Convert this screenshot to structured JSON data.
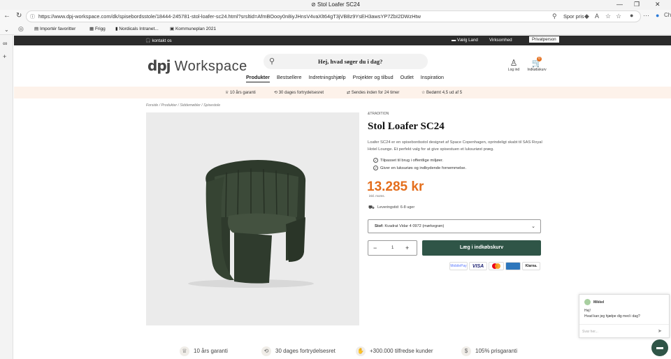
{
  "browser": {
    "tab_title": "Stol Loafer SC24",
    "url": "https://www.dpj-workspace.com/dk/spisebordsstole/18444-245781-stol-loafer-sc24.html?srsltid=AfmBOooy0n8iyJHnsV4vaXlt64gT3jVB8z9YsEH3awsYP7ZbI2DWzHtw",
    "spor_pris": "Spor pris",
    "favorites": [
      "Importér favoritter",
      "Frigg",
      "Nordicals Intranet...",
      "Kommuneplan 2021"
    ],
    "side_tab": "Ch"
  },
  "topstrip": {
    "contact": "kontakt os",
    "country": "Vælg Land",
    "business": "Virksomhed",
    "private": "Privatperson"
  },
  "header": {
    "logo_mark": "dpj",
    "logo_text": "Workspace",
    "search_placeholder": "Hej, hvad søger du i dag?",
    "menu": [
      "Produkter",
      "Bestsellere",
      "Indretningshjælp",
      "Projekter og tilbud",
      "Outlet",
      "Inspiration"
    ],
    "login": "Log ind",
    "cart": "Indkøbskurv",
    "cart_count": "0"
  },
  "usp": [
    "10 års garanti",
    "30 dages fortrydelsesret",
    "Sendes inden for 24 timer",
    "Bedømt 4,5 ud af 5"
  ],
  "breadcrumb": "Forside / Produkter / Siddemøbler / Spisestole",
  "product": {
    "brand": "&TRADITION",
    "title": "Stol Loafer SC24",
    "description": "Loafer SC24 er en spisebordsstol designet af Space Copenhagen, oprindeligt skabt til SAS Royal Hotel Lounge. Et perfekt valg for at give spisestuen et luksuriøst præg.",
    "bullets": [
      "Tilpasset til brug i offentlige miljøer.",
      "Giver en luksuriøs og indbydende fornemmelse."
    ],
    "price": "13.285 kr",
    "price_note": "inkl. moms.",
    "delivery": "Leveringstid: 6-8 uger",
    "option_label": "Stof:",
    "option_value": "Kvadrat Vidar 4 0972 (mørkegrøn)",
    "quantity": "1",
    "add_to_cart": "Læg i indkøbskurv",
    "payments": [
      "MobilePay",
      "VISA",
      "",
      "",
      "Klarna."
    ]
  },
  "chat": {
    "agent": "Mikkel",
    "greeting": "Hej!",
    "message": "Hvad kan jeg hjælpe dig med i dag?",
    "input_placeholder": "Svar her..."
  },
  "bottom_usp": [
    "10 års garanti",
    "30 dages fortrydelsesret",
    "+300.000 tilfredse kunder",
    "105% prisgaranti"
  ],
  "colors": {
    "accent": "#2f5547",
    "price": "#e46e1c",
    "usp_bg": "#fdf2ea"
  }
}
